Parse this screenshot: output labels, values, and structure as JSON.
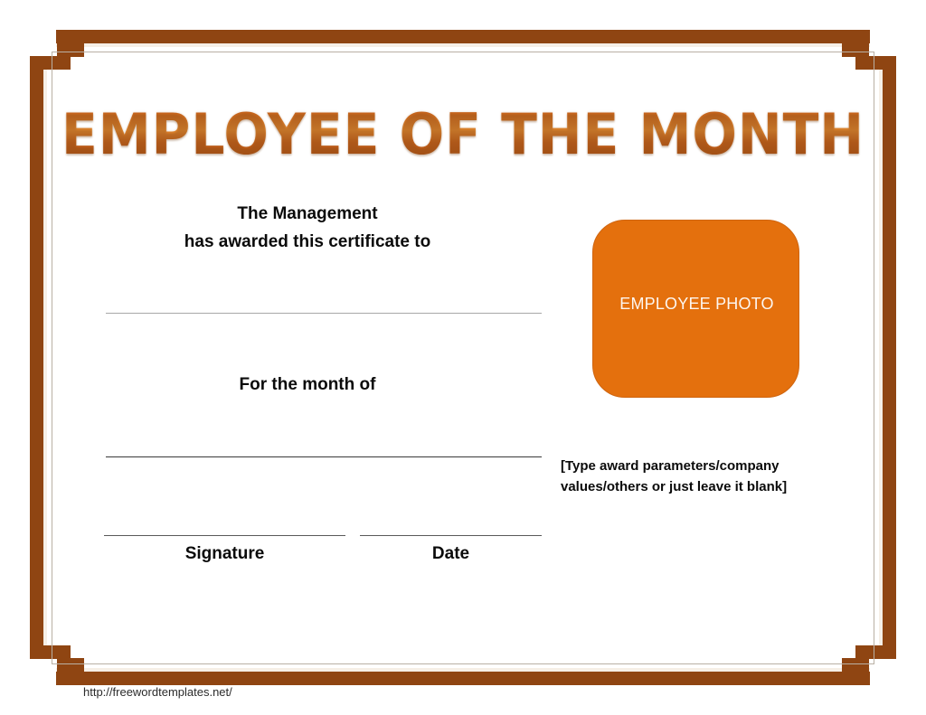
{
  "document": {
    "type": "certificate-template",
    "title": "EMPLOYEE OF THE MONTH"
  },
  "colors": {
    "border_brown": "#8f4512",
    "title_orange": "#c2601a",
    "photo_orange": "#e4700d",
    "photo_label": "#fdf6f0",
    "body_text": "#0b0b0b",
    "rule_light": "#a8a8a8",
    "rule_dark": "#3a3a3a",
    "hairline": "#b9b0a4",
    "cream": "#f6efe6"
  },
  "body": {
    "awarder_line_1": "The Management",
    "awarder_line_2": "has awarded this certificate to",
    "month_prompt": "For the month of"
  },
  "fields": {
    "recipient_name": "",
    "month": "",
    "signature": "",
    "date": "",
    "signature_label": "Signature",
    "date_label": "Date"
  },
  "photo": {
    "placeholder_label": "EMPLOYEE PHOTO"
  },
  "note": {
    "text": "[Type award parameters/company values/others or just leave it blank]"
  },
  "footer": {
    "url": "http://freewordtemplates.net/"
  }
}
